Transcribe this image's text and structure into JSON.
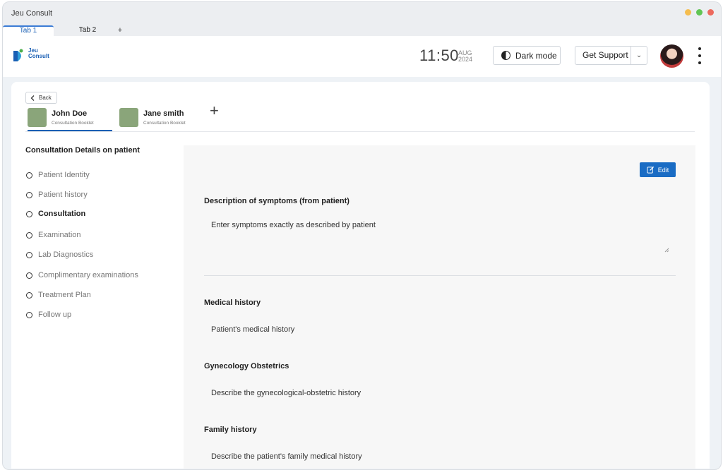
{
  "window": {
    "title": "Jeu Consult",
    "tabs": [
      {
        "label": "Tab 1"
      },
      {
        "label": "Tab 2"
      }
    ],
    "add_tab": "+"
  },
  "header": {
    "brand_line1": "Jeu",
    "brand_line2": "Consult",
    "time": "11:50",
    "month": "AUG",
    "year": "2024",
    "dark_mode_label": "Dark mode",
    "support_label": "Get Support"
  },
  "patients": {
    "back_label": "Back",
    "tabs": [
      {
        "name": "John Doe",
        "subtitle": "Consultation Booklet"
      },
      {
        "name": "Jane smith",
        "subtitle": "Consultation Booklet"
      }
    ],
    "add_label": "+"
  },
  "sidebar": {
    "title": "Consultation Details on patient",
    "steps": [
      {
        "label": "Patient Identity"
      },
      {
        "label": "Patient history"
      },
      {
        "label": "Consultation"
      },
      {
        "label": "Examination"
      },
      {
        "label": "Lab Diagnostics"
      },
      {
        "label": "Complimentary examinations"
      },
      {
        "label": "Treatment Plan"
      },
      {
        "label": "Follow up"
      }
    ],
    "active_step": "Consultation"
  },
  "form": {
    "edit_label": "Edit",
    "sections": [
      {
        "label": "Description of symptoms (from patient)",
        "value": "Enter symptoms exactly as described by patient"
      },
      {
        "label": "Medical history",
        "value": "Patient's medical history"
      },
      {
        "label": "Gynecology Obstetrics",
        "value": "Describe the gynecological-obstetric history"
      },
      {
        "label": "Family history",
        "value": "Describe the patient's family  medical history"
      }
    ]
  },
  "colors": {
    "accent": "#1a6cc4",
    "patient_thumb": "#8aa57a",
    "panel_bg": "#f7f7f7"
  }
}
